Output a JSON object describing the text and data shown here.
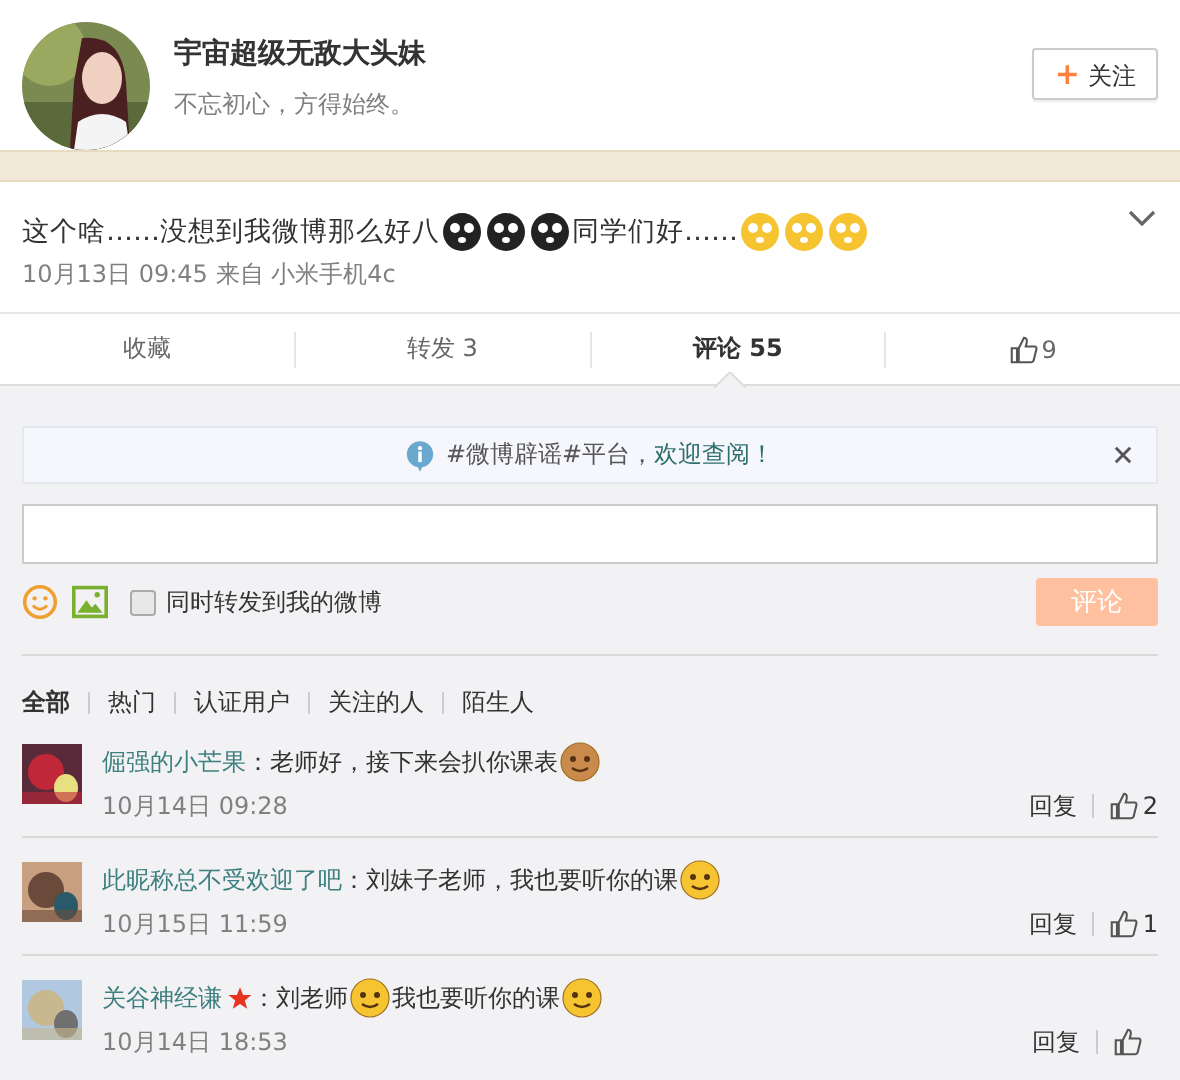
{
  "profile": {
    "name": "宇宙超级无敌大头妹",
    "bio": "不忘初心，方得始终。",
    "follow_button": {
      "icon": "+",
      "label": "关注"
    }
  },
  "post": {
    "content": [
      {
        "kind": "text",
        "text": "这个啥……没想到我微博那么好八"
      },
      {
        "kind": "dark"
      },
      {
        "kind": "dark"
      },
      {
        "kind": "dark"
      },
      {
        "kind": "text",
        "text": "同学们好……"
      },
      {
        "kind": "yellow"
      },
      {
        "kind": "yellow"
      },
      {
        "kind": "yellow"
      }
    ],
    "meta": "10月13日 09:45 来自 小米手机4c"
  },
  "actions": [
    {
      "kind": "text",
      "label": "收藏",
      "selected": false
    },
    {
      "kind": "text",
      "label": "转发 3",
      "selected": false
    },
    {
      "kind": "text",
      "label": "评论 55",
      "selected": true
    },
    {
      "kind": "like",
      "label": "9",
      "selected": false
    }
  ],
  "notice": {
    "text": "#微博辟谣#平台，",
    "link": "欢迎查阅！"
  },
  "composer": {
    "repost_label": "同时转发到我的微博",
    "repost_checked": false,
    "submit": "评论"
  },
  "filters": [
    {
      "label": "全部",
      "selected": true
    },
    {
      "label": "热门",
      "selected": false
    },
    {
      "label": "认证用户",
      "selected": false
    },
    {
      "label": "关注的人",
      "selected": false
    },
    {
      "label": "陌生人",
      "selected": false
    }
  ],
  "comments": [
    {
      "user": "倔强的小芒果",
      "verified": false,
      "content": [
        {
          "kind": "text",
          "text": "：老师好，接下来会扒你课表"
        },
        {
          "kind": "dog"
        }
      ],
      "time": "10月14日 09:28",
      "reply": "回复",
      "likes": "2"
    },
    {
      "user": "此昵称总不受欢迎了吧",
      "verified": false,
      "content": [
        {
          "kind": "text",
          "text": "：刘妹子老师，我也要听你的课"
        },
        {
          "kind": "laugh"
        }
      ],
      "time": "10月15日 11:59",
      "reply": "回复",
      "likes": "1"
    },
    {
      "user": "关谷神经谦",
      "verified": true,
      "content": [
        {
          "kind": "text",
          "text": "：刘老师"
        },
        {
          "kind": "blush"
        },
        {
          "kind": "text",
          "text": "我也要听你的课"
        },
        {
          "kind": "blush"
        }
      ],
      "time": "10月14日 18:53",
      "reply": "回复"
    }
  ]
}
